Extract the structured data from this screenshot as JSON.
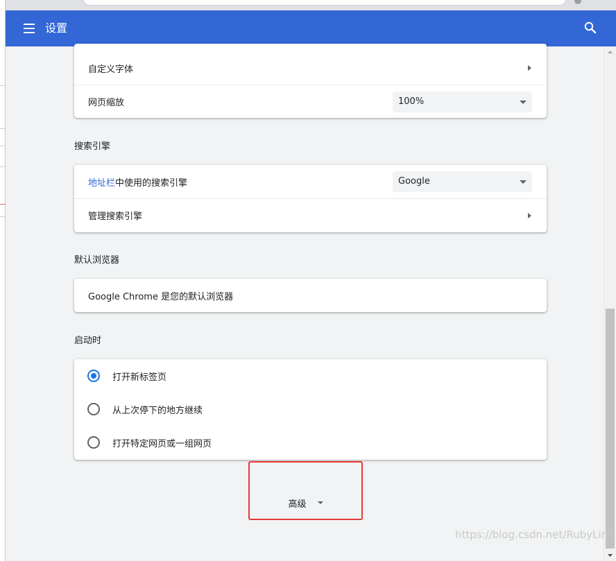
{
  "toolbar": {
    "title": "设置"
  },
  "appearance": {
    "custom_fonts_label": "自定义字体",
    "page_zoom_label": "网页缩放",
    "page_zoom_value": "100%"
  },
  "search_engine": {
    "section_title": "搜索引擎",
    "address_bar_link": "地址栏",
    "address_bar_rest": "中使用的搜索引擎",
    "selected_engine": "Google",
    "manage_label": "管理搜索引擎"
  },
  "default_browser": {
    "section_title": "默认浏览器",
    "status_text": "Google Chrome 是您的默认浏览器"
  },
  "on_startup": {
    "section_title": "启动时",
    "options": [
      {
        "label": "打开新标签页",
        "checked": true
      },
      {
        "label": "从上次停下的地方继续",
        "checked": false
      },
      {
        "label": "打开特定网页或一组网页",
        "checked": false
      }
    ]
  },
  "advanced": {
    "label": "高级"
  },
  "watermark": "https://blog.csdn.net/RubyLinT",
  "colors": {
    "toolbar": "#3367d6",
    "radio_checked": "#1a73e8",
    "highlight_box": "#e53935"
  }
}
